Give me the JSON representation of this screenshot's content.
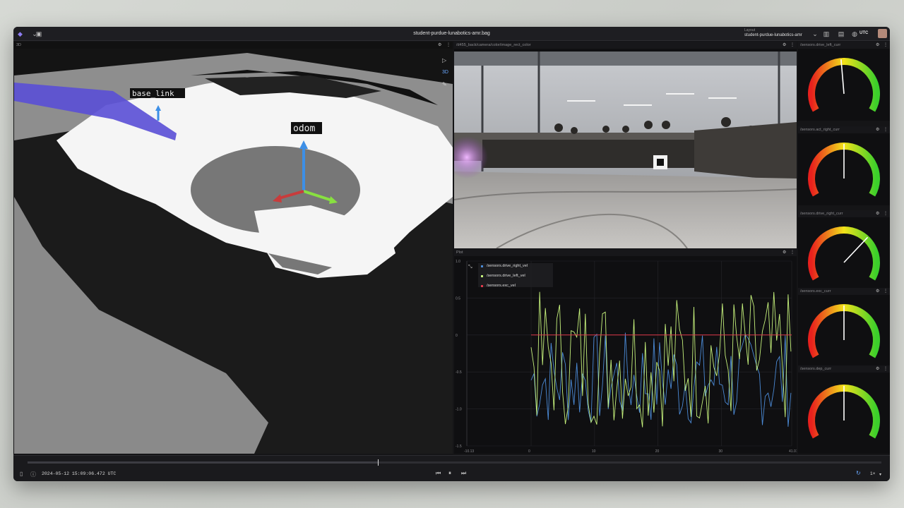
{
  "app": {
    "title": "student-purdue-lunabotics-amr.bag",
    "layout_label": "Layout",
    "layout_name": "student-purdue-lunabotics-amr",
    "timezone": "UTC"
  },
  "panels": {
    "three_d": {
      "title": "3D",
      "frame_labels": [
        "base_link",
        "odom"
      ]
    },
    "image": {
      "title": "/d455_back/camera/color/image_rect_color"
    },
    "plot": {
      "title": "Plot",
      "legend": [
        {
          "name": "/sensors.drive_right_vel",
          "color": "#4b8ad6"
        },
        {
          "name": "/sensors.drive_left_vel",
          "color": "#c6f27c"
        },
        {
          "name": "/sensors.exc_vel",
          "color": "#e0394a"
        }
      ],
      "y_ticks": [
        "1.0",
        "0.5",
        "0",
        "-0.5",
        "-1.0",
        "-1.5"
      ],
      "x_ticks": [
        "-10.13",
        "0",
        "10",
        "20",
        "30",
        "41.07"
      ]
    },
    "gauges": [
      {
        "title": "/sensors.drive_left_curr",
        "value": 0.48
      },
      {
        "title": "/sensors.act_right_curr",
        "value": 0.5
      },
      {
        "title": "/sensors.drive_right_curr",
        "value": 0.68
      },
      {
        "title": "/sensors.exc_curr",
        "value": 0.5
      },
      {
        "title": "/sensors.dep_curr",
        "value": 0.5
      }
    ]
  },
  "playback": {
    "timestamp": "2024-05-12 15:09:06.472 UTC",
    "progress": 0.41,
    "speed": "1×"
  },
  "colors": {
    "accent": "#8d7cf2",
    "background": "#151517"
  }
}
